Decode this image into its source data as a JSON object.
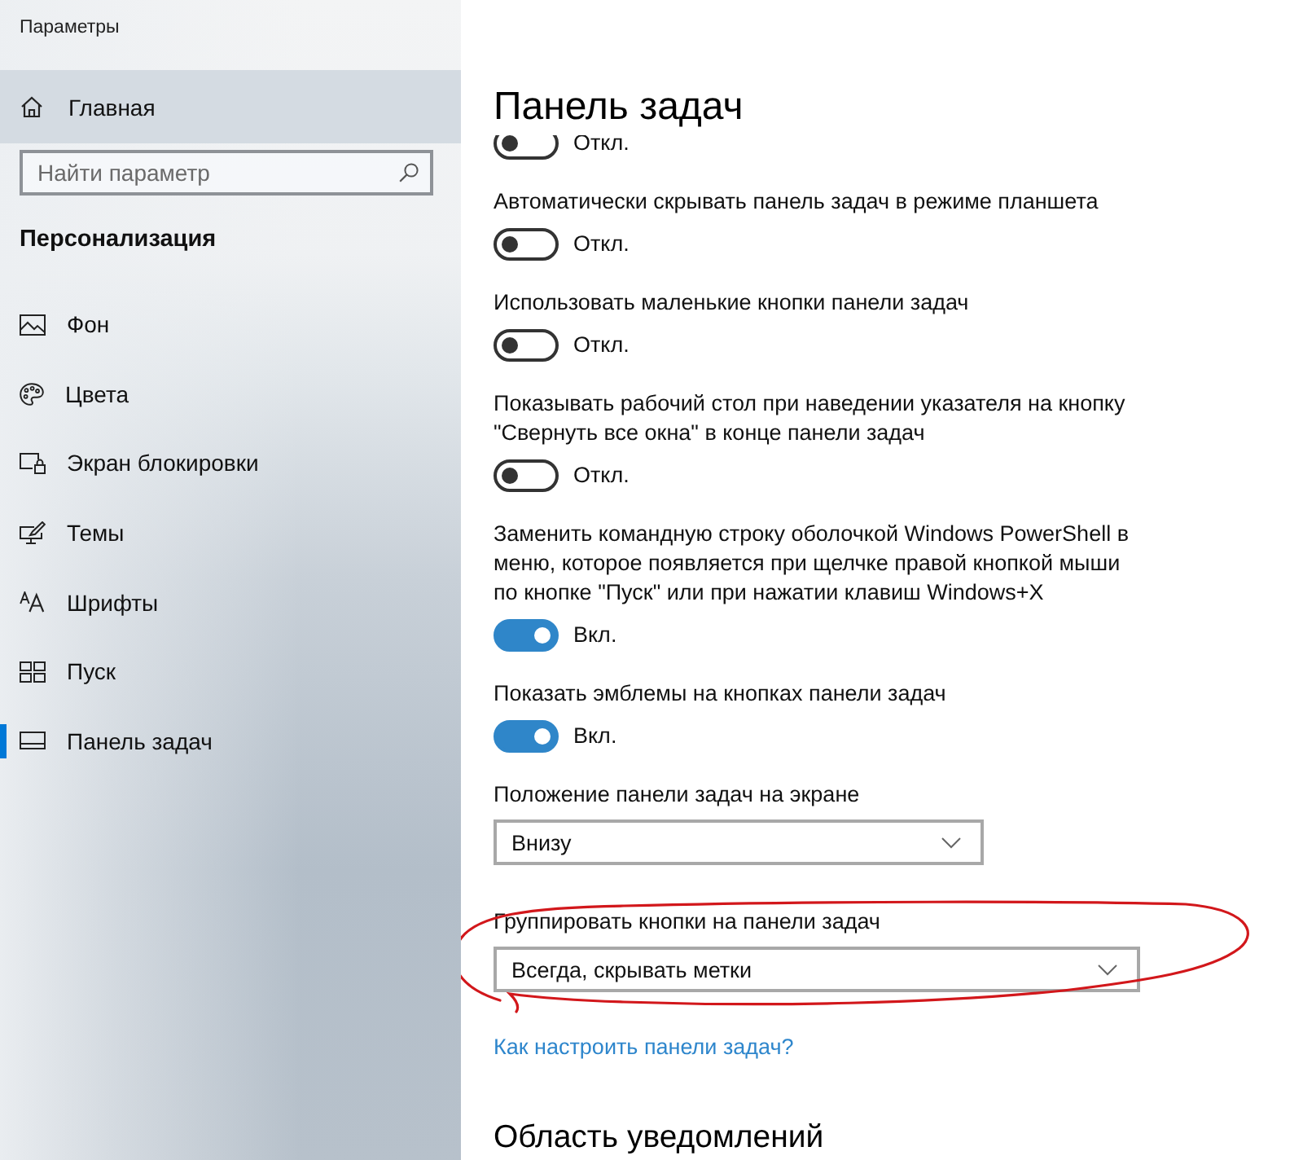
{
  "window": {
    "title": "Параметры"
  },
  "sidebar": {
    "home": {
      "label": "Главная"
    },
    "search": {
      "placeholder": "Найти параметр"
    },
    "section": "Персонализация",
    "items": [
      {
        "label": "Фон",
        "selected": false
      },
      {
        "label": "Цвета",
        "selected": false
      },
      {
        "label": "Экран блокировки",
        "selected": false
      },
      {
        "label": "Темы",
        "selected": false
      },
      {
        "label": "Шрифты",
        "selected": false
      },
      {
        "label": "Пуск",
        "selected": false
      },
      {
        "label": "Панель задач",
        "selected": true
      }
    ]
  },
  "main": {
    "title": "Панель задач",
    "settings": [
      {
        "kind": "toggle",
        "on": false,
        "state_text": "Откл.",
        "highlighted": false
      },
      {
        "kind": "toggle",
        "label": "Автоматически скрывать панель задач в режиме планшета",
        "on": false,
        "state_text": "Откл.",
        "highlighted": false
      },
      {
        "kind": "toggle",
        "label": "Использовать маленькие кнопки панели задач",
        "on": false,
        "state_text": "Откл.",
        "highlighted": false
      },
      {
        "kind": "toggle",
        "label": "Показывать рабочий стол при наведении указателя на кнопку\n\"Свернуть все окна\" в конце панели задач",
        "on": false,
        "state_text": "Откл.",
        "highlighted": false
      },
      {
        "kind": "toggle",
        "label": "Заменить командную строку оболочкой Windows PowerShell в\nменю, которое появляется при щелчке правой кнопкой мыши\nпо кнопке \"Пуск\" или при нажатии клавиш Windows+X",
        "on": true,
        "state_text": "Вкл.",
        "highlighted": false
      },
      {
        "kind": "toggle",
        "label": "Показать эмблемы на кнопках панели задач",
        "on": true,
        "state_text": "Вкл.",
        "highlighted": false
      },
      {
        "kind": "dropdown",
        "label": "Положение панели задач на экране",
        "value": "Внизу",
        "highlighted": false
      },
      {
        "kind": "dropdown",
        "label": "Группировать кнопки на панели задач",
        "value": "Всегда, скрывать метки",
        "highlighted": true
      }
    ],
    "link": "Как настроить панели задач?",
    "next_section": "Область уведомлений"
  }
}
